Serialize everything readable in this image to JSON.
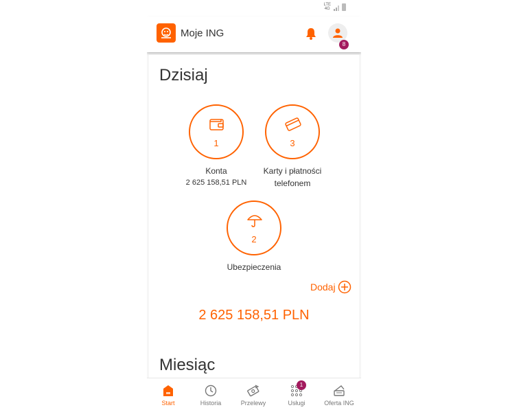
{
  "status_bar": {
    "network": "LTE",
    "network_sub": "4G"
  },
  "header": {
    "title": "Moje ING",
    "profile_badge": "8"
  },
  "today": {
    "title": "Dzisiaj",
    "tiles": [
      {
        "count": "1",
        "label": "Konta",
        "amount": "2 625 158,51 PLN",
        "icon": "wallet-icon"
      },
      {
        "count": "3",
        "label_line1": "Karty i płatności",
        "label_line2": "telefonem",
        "icon": "card-icon"
      },
      {
        "count": "2",
        "label": "Ubezpieczenia",
        "icon": "umbrella-icon"
      }
    ],
    "add_label": "Dodaj",
    "total": "2 625 158,51 PLN"
  },
  "month": {
    "title": "Miesiąc"
  },
  "nav": {
    "items": [
      {
        "label": "Start",
        "icon": "home-icon",
        "active": true
      },
      {
        "label": "Historia",
        "icon": "clock-icon"
      },
      {
        "label": "Przelewy",
        "icon": "transfer-icon"
      },
      {
        "label": "Usługi",
        "icon": "grid-icon",
        "badge": "1"
      },
      {
        "label": "Oferta ING",
        "icon": "offer-icon"
      }
    ]
  },
  "colors": {
    "accent": "#ff6200",
    "badge": "#a31b5e",
    "text": "#333333"
  }
}
